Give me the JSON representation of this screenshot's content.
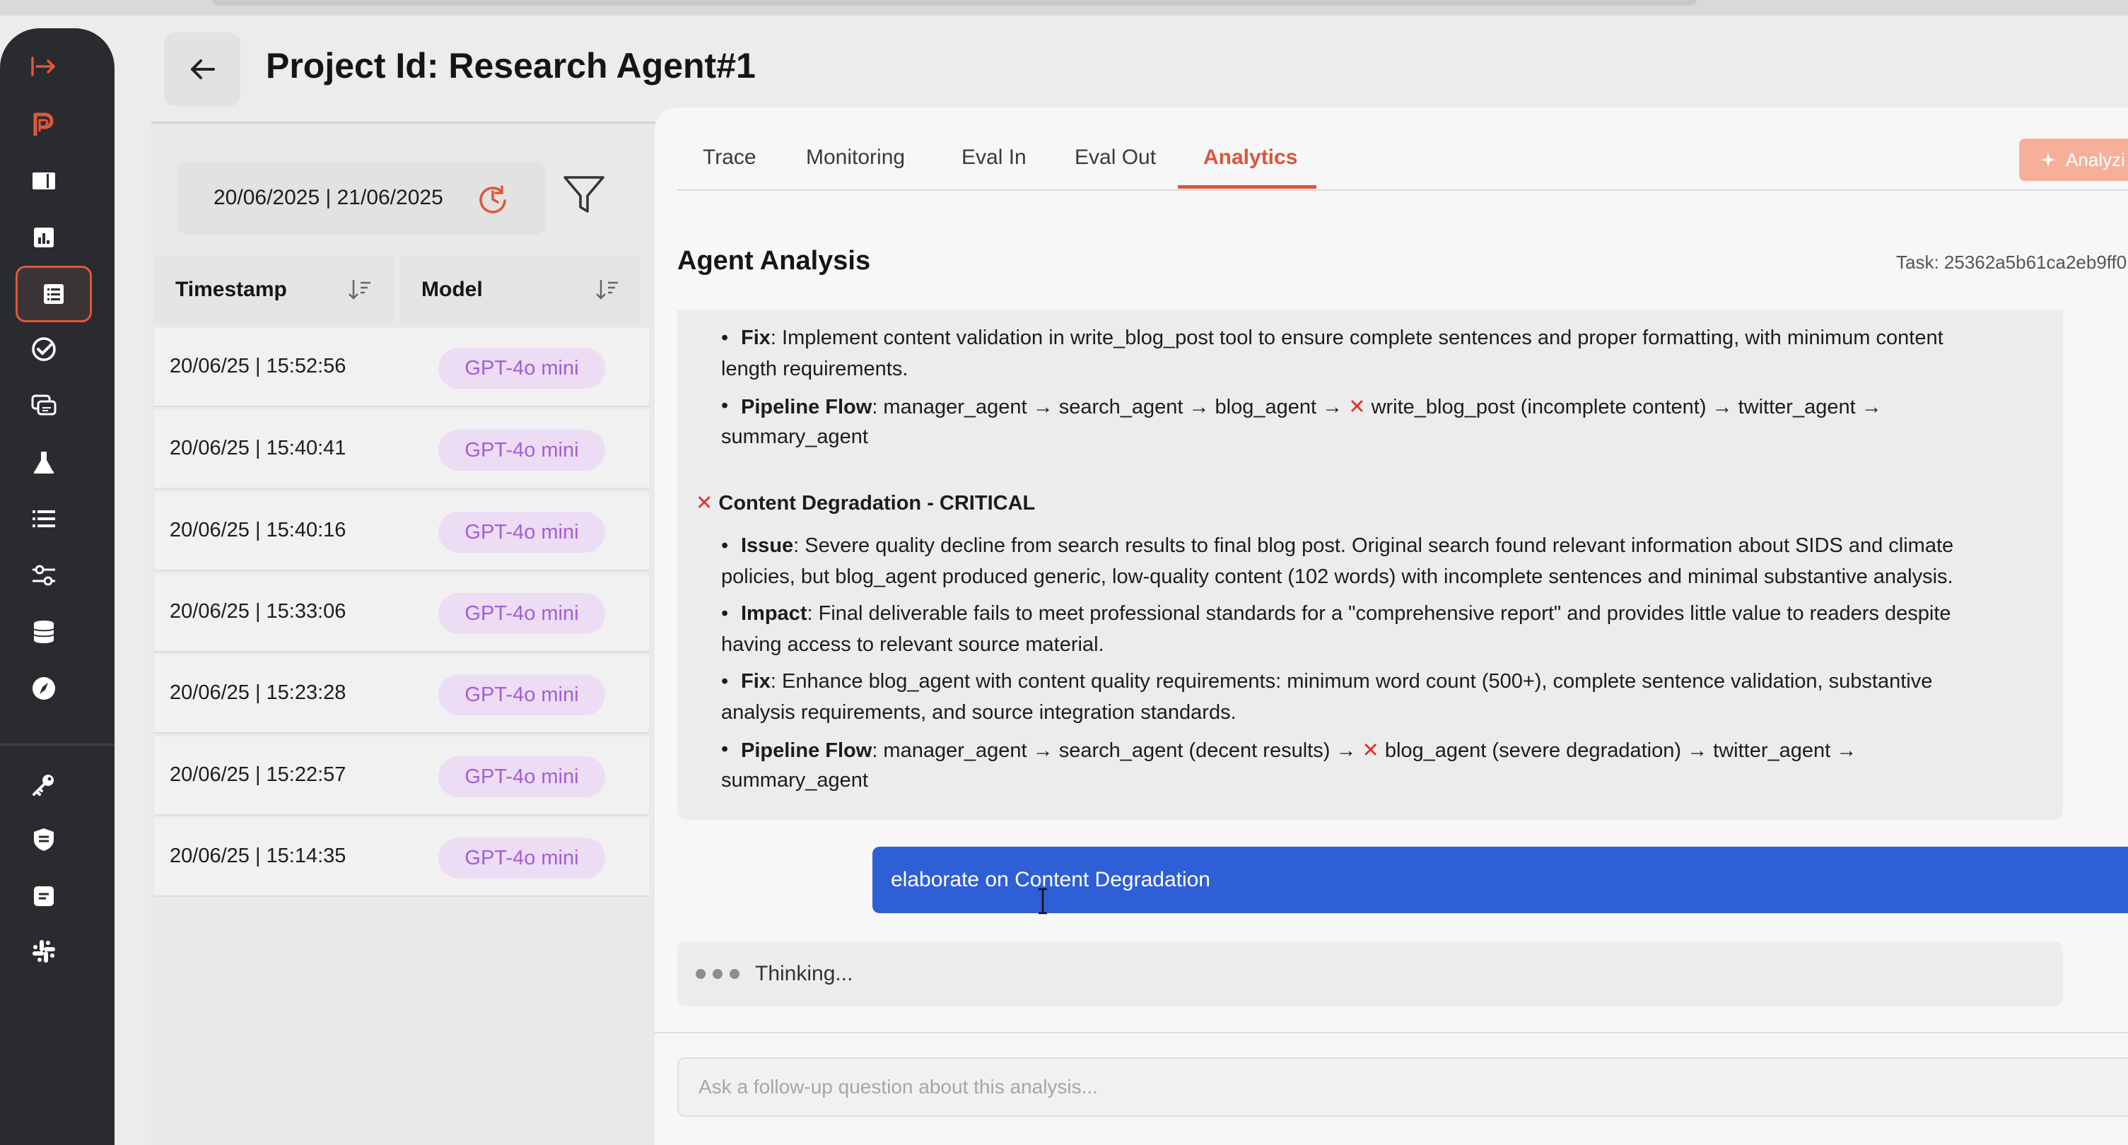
{
  "header": {
    "title": "Project Id: Research Agent#1"
  },
  "filters": {
    "date_range": "20/06/2025 | 21/06/2025"
  },
  "table": {
    "columns": [
      "Timestamp",
      "Model"
    ],
    "rows": [
      {
        "timestamp": "20/06/25 | 15:52:56",
        "model": "GPT-4o mini"
      },
      {
        "timestamp": "20/06/25 | 15:40:41",
        "model": "GPT-4o mini"
      },
      {
        "timestamp": "20/06/25 | 15:40:16",
        "model": "GPT-4o mini"
      },
      {
        "timestamp": "20/06/25 | 15:33:06",
        "model": "GPT-4o mini"
      },
      {
        "timestamp": "20/06/25 | 15:23:28",
        "model": "GPT-4o mini"
      },
      {
        "timestamp": "20/06/25 | 15:22:57",
        "model": "GPT-4o mini"
      },
      {
        "timestamp": "20/06/25 | 15:14:35",
        "model": "GPT-4o mini"
      }
    ]
  },
  "tabs": [
    {
      "label": "Trace"
    },
    {
      "label": "Monitoring"
    },
    {
      "label": "Eval In"
    },
    {
      "label": "Eval Out"
    },
    {
      "label": "Analytics"
    }
  ],
  "active_tab": "Analytics",
  "analyze_button": "Analyzi",
  "analysis": {
    "title": "Agent Analysis",
    "task_id": "Task: 25362a5b61ca2eb9ff0",
    "fix1": {
      "label": "Fix",
      "line1": ": Implement content validation in write_blog_post tool to ensure complete sentences and proper formatting, with minimum content",
      "line2": "length requirements."
    },
    "flow1": {
      "label": "Pipeline Flow",
      "line1a": ": manager_agent → search_agent → blog_agent → ",
      "line1b": " write_blog_post (incomplete content) → twitter_agent →",
      "line2": "summary_agent"
    },
    "critical_heading": "Content Degradation - CRITICAL",
    "issue": {
      "label": "Issue",
      "line1": ": Severe quality decline from search results to final blog post. Original search found relevant information about SIDS and climate",
      "line2": "policies, but blog_agent produced generic, low-quality content (102 words) with incomplete sentences and minimal substantive analysis."
    },
    "impact": {
      "label": "Impact",
      "line1": ": Final deliverable fails to meet professional standards for a \"comprehensive report\" and provides little value to readers despite",
      "line2": "having access to relevant source material."
    },
    "fix2": {
      "label": "Fix",
      "line1": ": Enhance blog_agent with content quality requirements: minimum word count (500+), complete sentence validation, substantive",
      "line2": "analysis requirements, and source integration standards."
    },
    "flow2": {
      "label": "Pipeline Flow",
      "line1a": ": manager_agent → search_agent (decent results) → ",
      "line1b": " blog_agent (severe degradation) → twitter_agent →",
      "line2": "summary_agent"
    }
  },
  "chat": {
    "user_message": "elaborate on Content Degradation",
    "thinking": "Thinking...",
    "input_placeholder": "Ask a follow-up question about this analysis..."
  },
  "colors": {
    "accent": "#d9563a",
    "user_bubble": "#2f5fd6",
    "badge_bg": "#ecdcf4",
    "badge_text": "#a45ed6",
    "critical": "#e0302a"
  }
}
